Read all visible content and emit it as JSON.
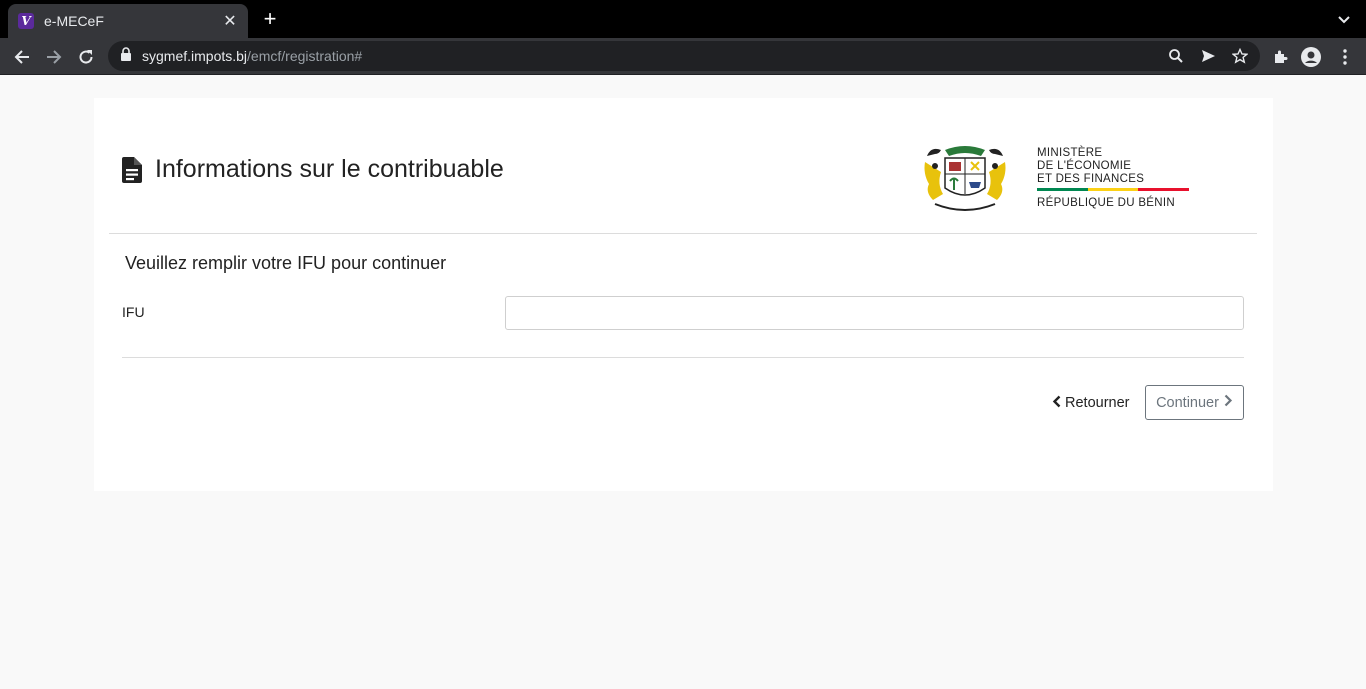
{
  "browser": {
    "tab_title": "e-MECeF",
    "favicon_letter": "V",
    "url_host": "sygmef.impots.bj",
    "url_path": "/emcf/registration#"
  },
  "page": {
    "title": "Informations sur le contribuable",
    "subtitle": "Veuillez remplir votre IFU pour continuer",
    "ifu_label": "IFU",
    "ifu_value": "",
    "back_label": "Retourner",
    "continue_label": "Continuer"
  },
  "logo": {
    "ministry_line1": "MINISTÈRE",
    "ministry_line2": "DE L'ÉCONOMIE",
    "ministry_line3": "ET DES FINANCES",
    "republic": "RÉPUBLIQUE DU BÉNIN",
    "flag_colors": [
      "#008751",
      "#fcd116",
      "#e8112d"
    ]
  },
  "colors": {
    "tabbar_bg": "#000000",
    "toolbar_bg": "#35363a",
    "page_bg": "#f9f9f9",
    "favicon_bg": "#5b2a9c"
  }
}
